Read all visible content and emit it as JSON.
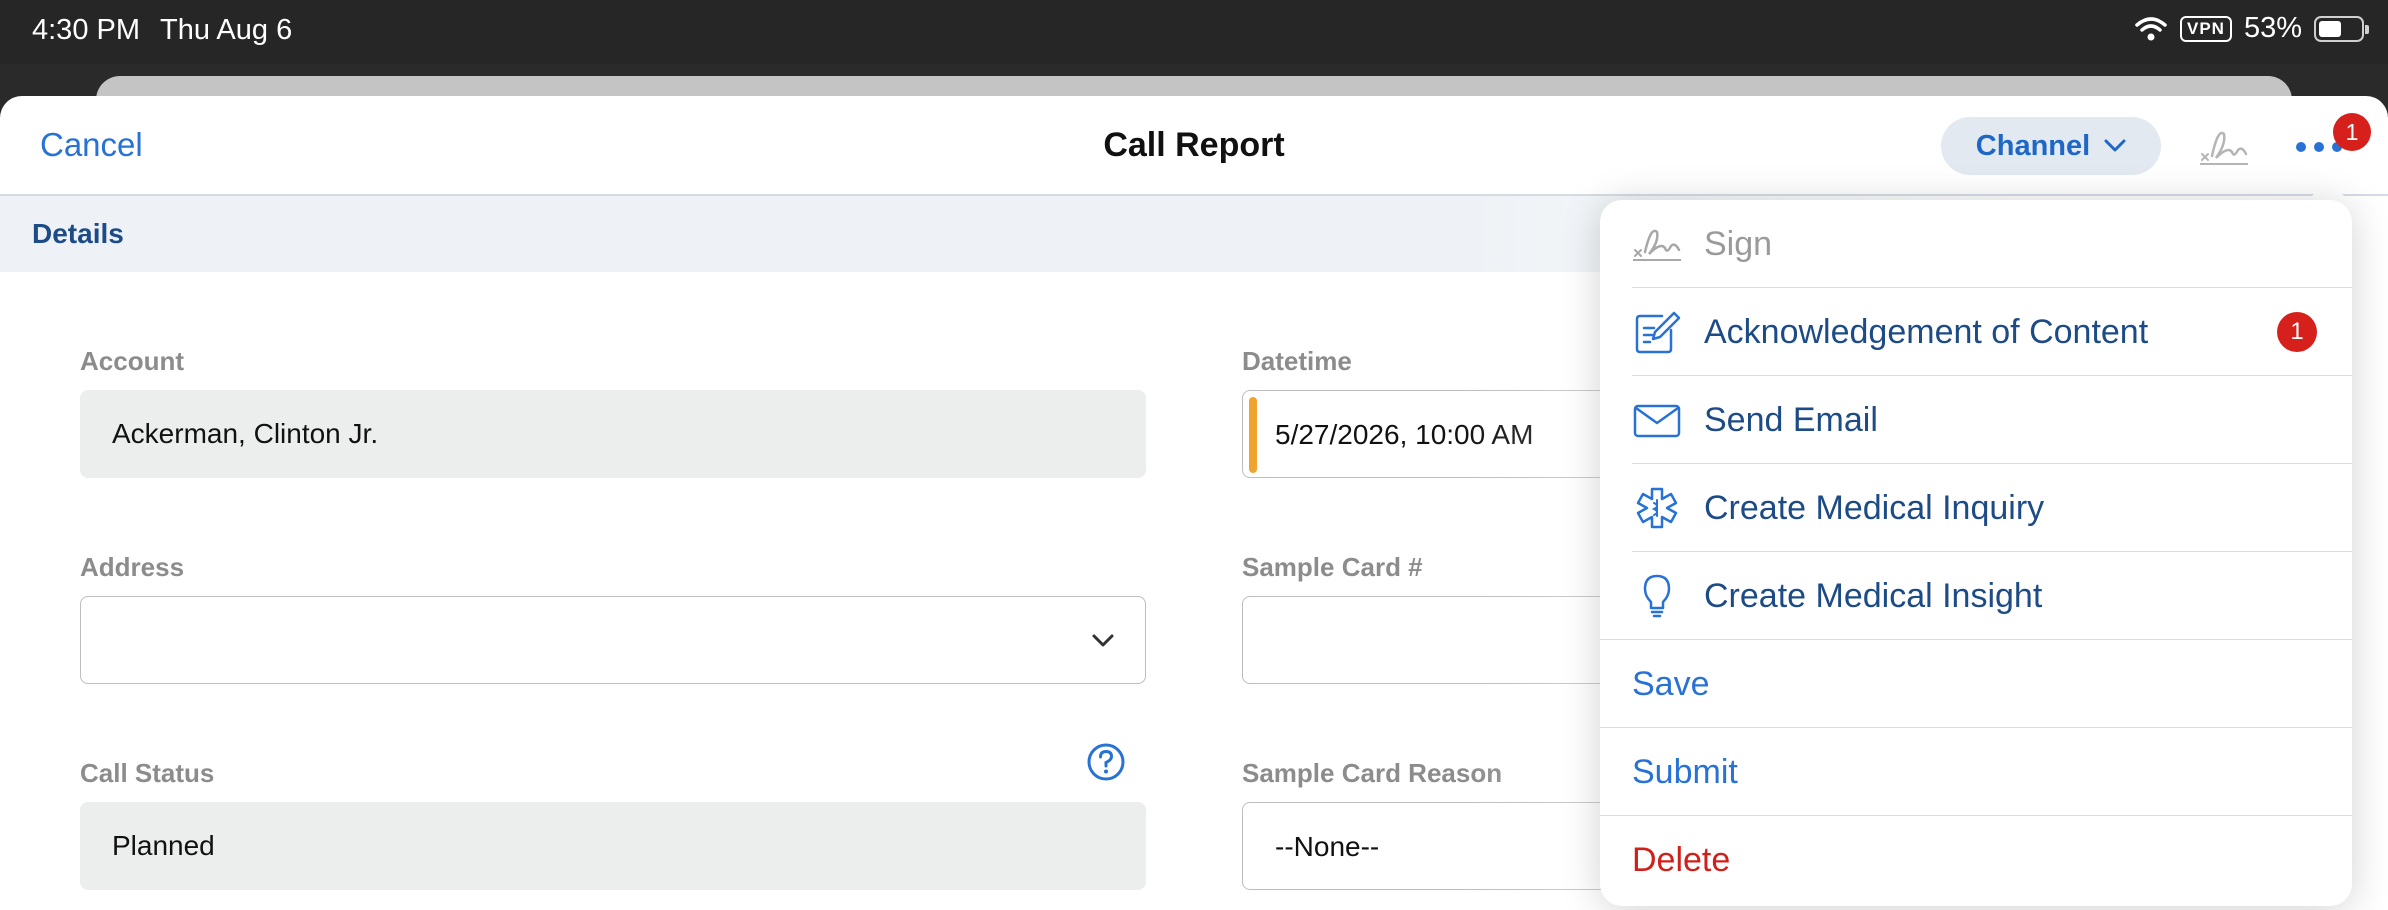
{
  "status_bar": {
    "time": "4:30 PM",
    "date": "Thu Aug 6",
    "vpn": "VPN",
    "battery": "53%"
  },
  "nav": {
    "cancel": "Cancel",
    "title": "Call Report",
    "channel": "Channel",
    "more_badge": "1"
  },
  "section": {
    "title": "Details"
  },
  "fields": {
    "account_label": "Account",
    "account_value": "Ackerman, Clinton Jr.",
    "address_label": "Address",
    "address_value": "",
    "call_status_label": "Call Status",
    "call_status_value": "Planned",
    "datetime_label": "Datetime",
    "datetime_value": "5/27/2026, 10:00 AM",
    "sample_card_label": "Sample Card #",
    "sample_card_value": "",
    "sample_card_reason_label": "Sample Card Reason",
    "sample_card_reason_value": "--None--"
  },
  "menu": {
    "sign": "Sign",
    "acknowledgement": "Acknowledgement of Content",
    "acknowledgement_badge": "1",
    "send_email": "Send Email",
    "medical_inquiry": "Create Medical Inquiry",
    "medical_insight": "Create Medical Insight",
    "save": "Save",
    "submit": "Submit",
    "delete": "Delete"
  },
  "colors": {
    "accent": "#2872d6",
    "menu_text": "#1d4b86",
    "danger": "#d0201b",
    "required": "#f0a32d",
    "badge": "#d6201b"
  },
  "icons": [
    "wifi-icon",
    "battery-icon",
    "chevron-down-icon",
    "signature-icon",
    "more-icon",
    "help-icon",
    "edit-icon",
    "mail-icon",
    "medical-icon",
    "lightbulb-icon"
  ]
}
